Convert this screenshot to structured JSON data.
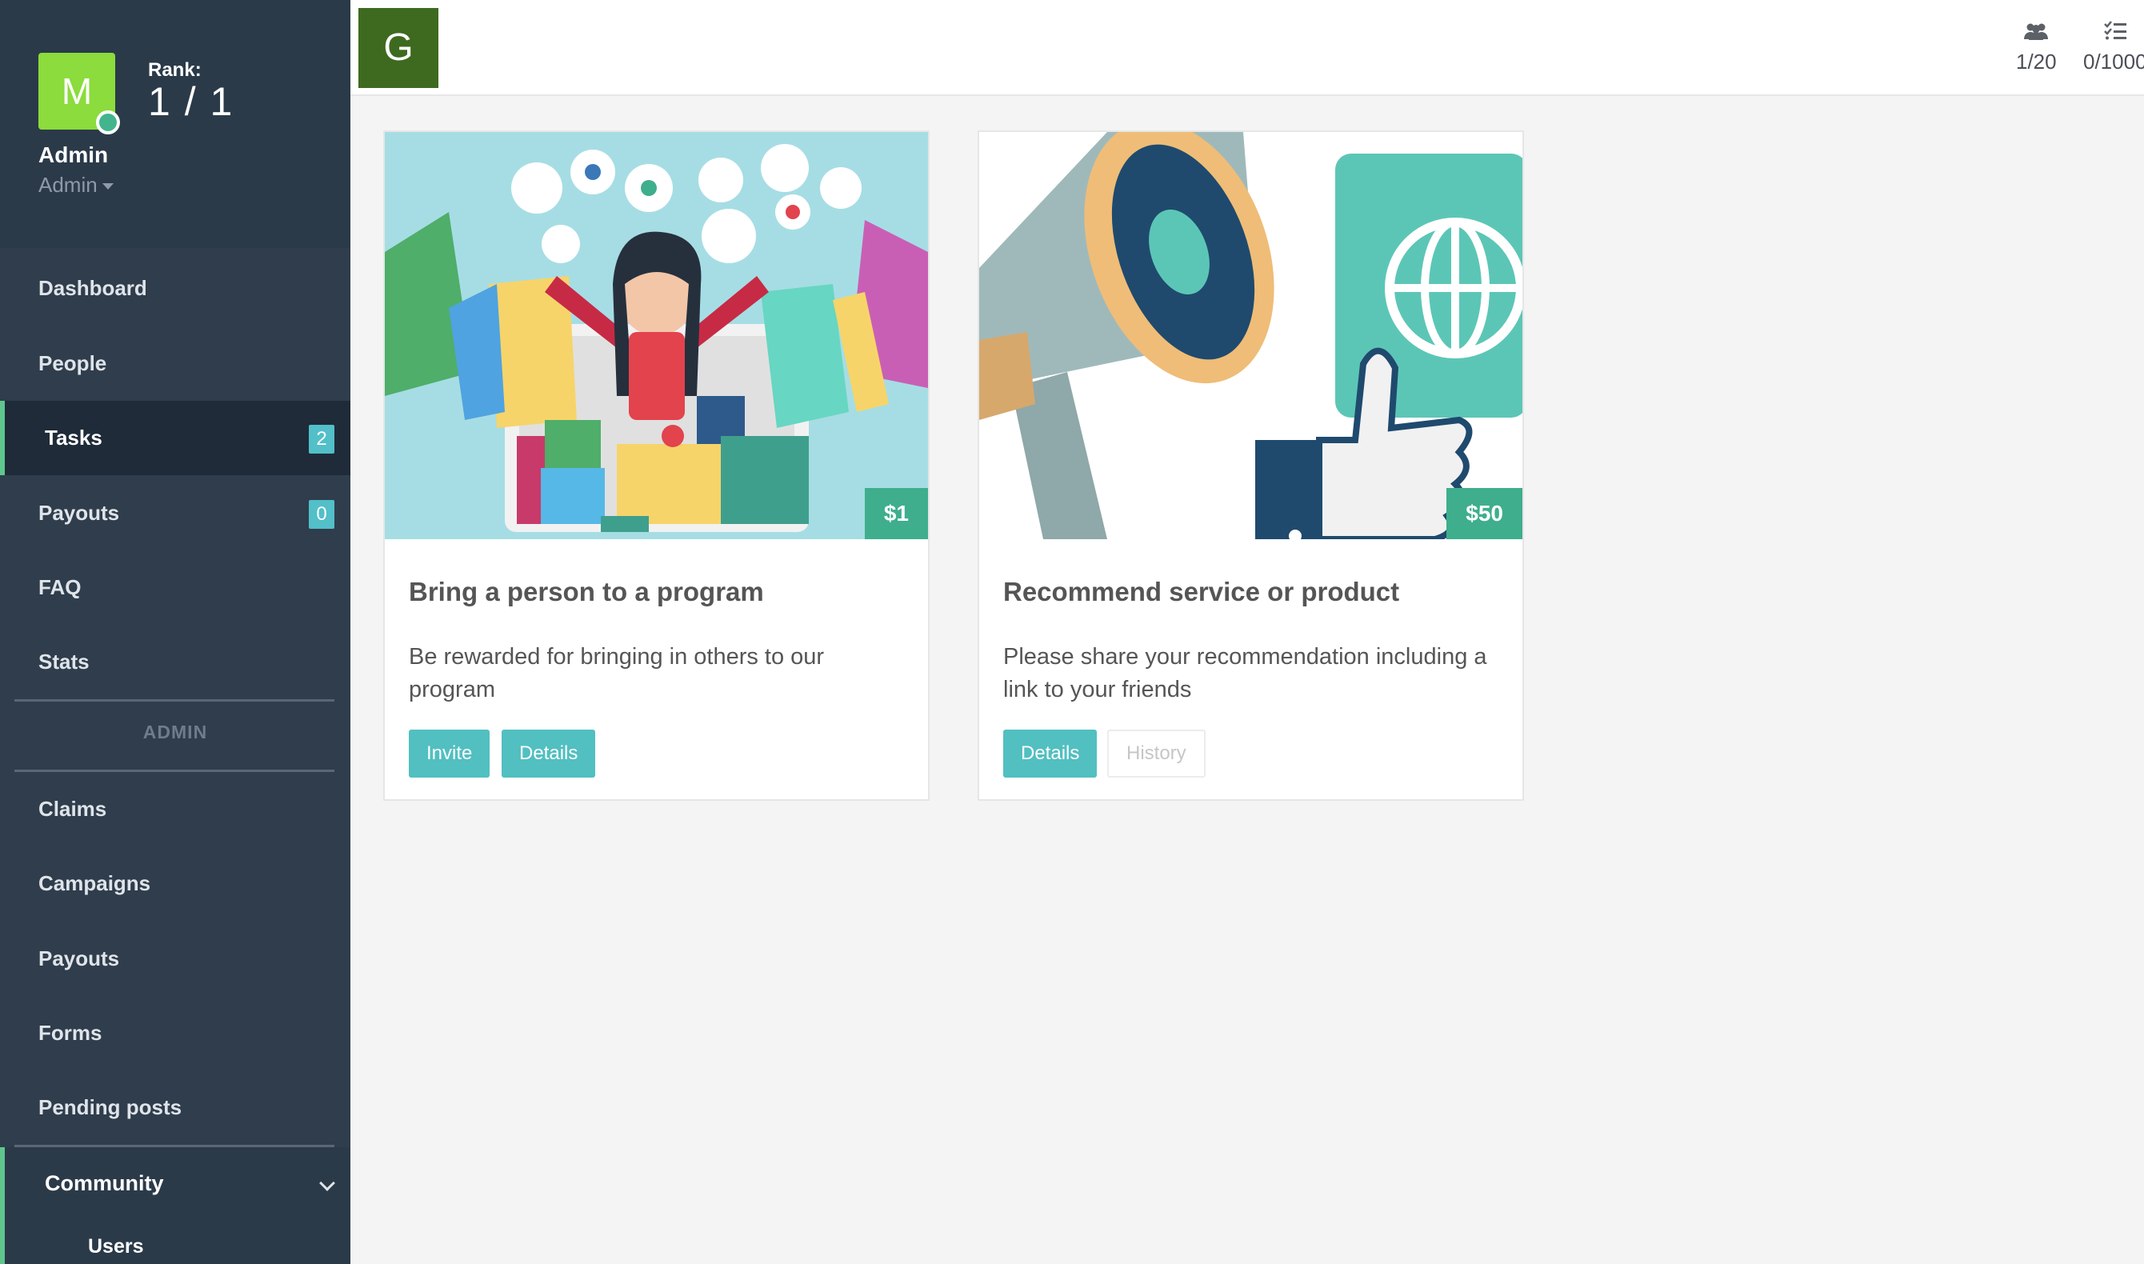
{
  "profile": {
    "avatar_letter": "M",
    "rank_label": "Rank:",
    "rank_value": "1 / 1",
    "name": "Admin",
    "role": "Admin"
  },
  "nav": {
    "dashboard": "Dashboard",
    "people": "People",
    "tasks": "Tasks",
    "tasks_badge": "2",
    "payouts": "Payouts",
    "payouts_badge": "0",
    "faq": "FAQ",
    "stats": "Stats",
    "admin_section": "ADMIN",
    "claims": "Claims",
    "campaigns": "Campaigns",
    "admin_payouts": "Payouts",
    "forms": "Forms",
    "pending_posts": "Pending posts",
    "community": "Community",
    "users": "Users"
  },
  "topbar": {
    "brand_letter": "G",
    "members": "1/20",
    "tasks_count": "0/1000"
  },
  "cards": [
    {
      "title": "Bring a person to a program",
      "description": "Be rewarded for bringing in others to our program",
      "price": "$1",
      "buttons": [
        "Invite",
        "Details"
      ]
    },
    {
      "title": "Recommend service or product",
      "description": "Please share your recommendation including a link to your friends",
      "price": "$50",
      "buttons": [
        "Details",
        "History"
      ]
    }
  ],
  "colors": {
    "sidebar": "#2f3d4c",
    "accent_green": "#5ec78d",
    "button_teal": "#52bfc1",
    "price_green": "#3fae8d",
    "brand_green": "#3e6a1f",
    "avatar_green": "#8bdc3c"
  },
  "icons": {
    "members": "users-icon",
    "tasks": "checklist-icon"
  }
}
